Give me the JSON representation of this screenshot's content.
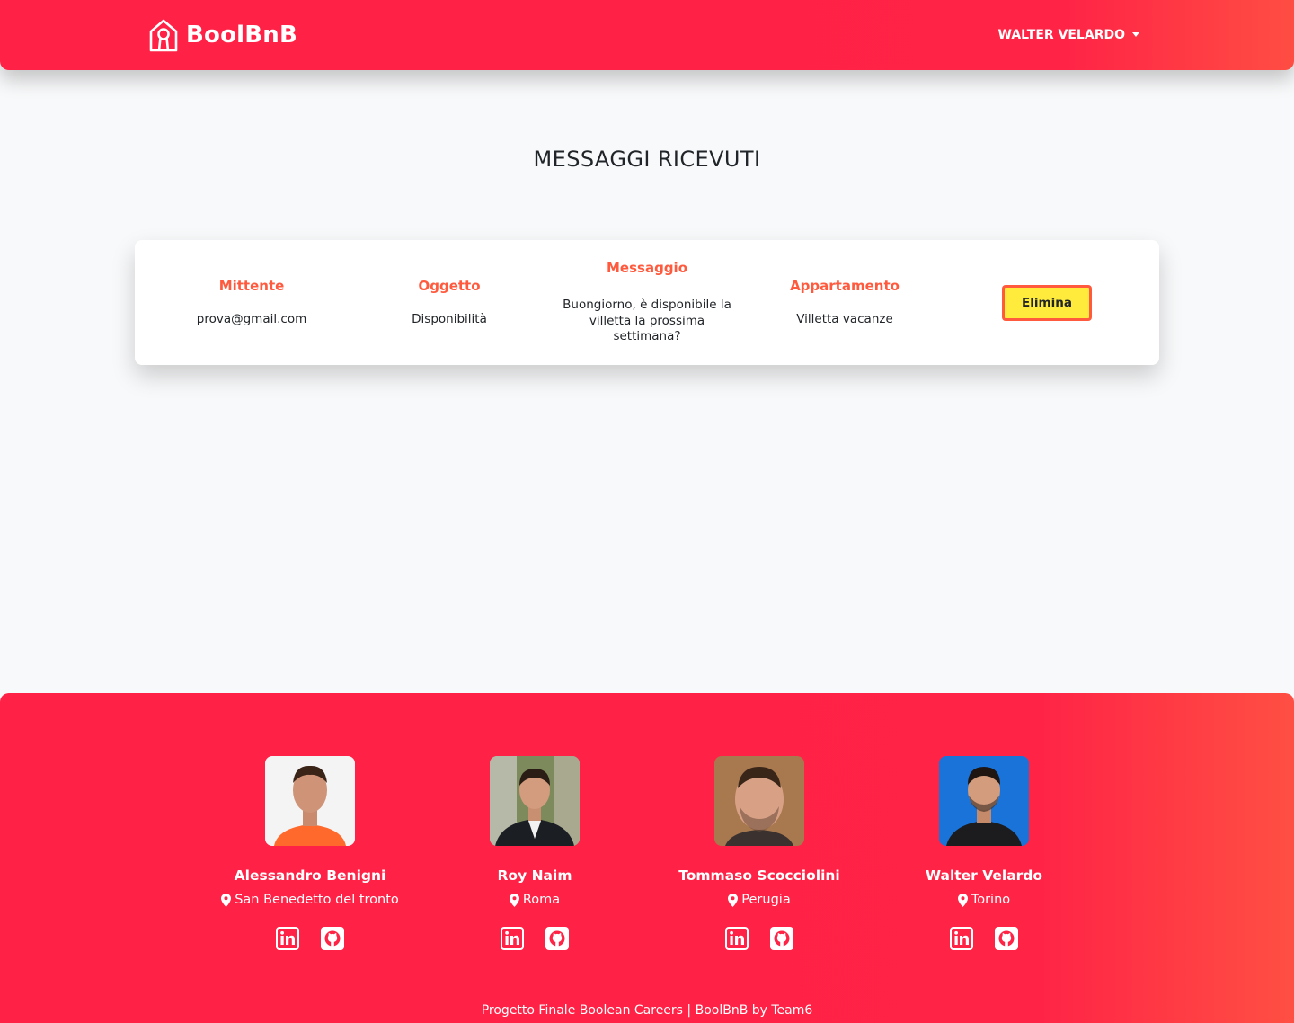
{
  "header": {
    "brand": "BoolBnB",
    "brand_icon": "house-keyhole-icon",
    "user_name": "WALTER VELARDO",
    "accent": "#ff2346"
  },
  "main": {
    "title": "MESSAGGI RICEVUTI",
    "columns": {
      "sender": "Mittente",
      "subject": "Oggetto",
      "message": "Messaggio",
      "apartment": "Appartamento"
    },
    "messages": [
      {
        "sender": "prova@gmail.com",
        "subject": "Disponibilità",
        "message": "Buongiorno, è disponibile la villetta la prossima settimana?",
        "apartment": "Villetta vacanze",
        "delete_label": "Elimina"
      }
    ]
  },
  "footer": {
    "members": [
      {
        "name": "Alessandro Benigni",
        "city": "San Benedetto del tronto",
        "photo_bg": "#ff6a2c"
      },
      {
        "name": "Roy Naim",
        "city": "Roma",
        "photo_bg": "#2c3a3f"
      },
      {
        "name": "Tommaso Scocciolini",
        "city": "Perugia",
        "photo_bg": "#a8784e"
      },
      {
        "name": "Walter Velardo",
        "city": "Torino",
        "photo_bg": "#1a73d9"
      }
    ],
    "social_icons": [
      "linkedin-icon",
      "github-icon"
    ],
    "note": "Progetto Finale Boolean Careers | BoolBnB by Team6"
  }
}
